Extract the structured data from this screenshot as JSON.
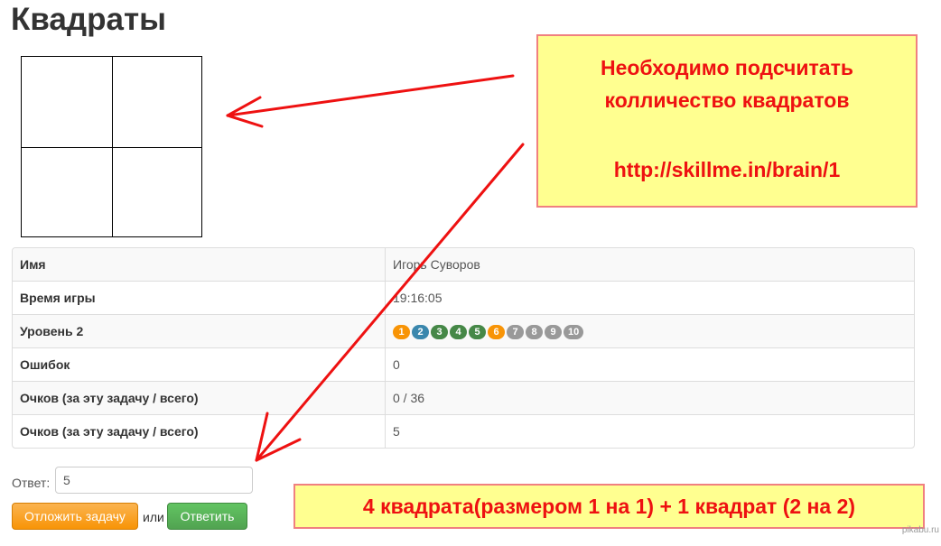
{
  "page": {
    "title": "Квадраты"
  },
  "table": {
    "rows": [
      {
        "label": "Имя",
        "value": "Игорь Суворов"
      },
      {
        "label": "Время игры",
        "value": "19:16:05"
      },
      {
        "label": "Уровень 2",
        "badges": [
          {
            "text": "1",
            "color": "#f89406"
          },
          {
            "text": "2",
            "color": "#3a87ad"
          },
          {
            "text": "3",
            "color": "#468847"
          },
          {
            "text": "4",
            "color": "#468847"
          },
          {
            "text": "5",
            "color": "#468847"
          },
          {
            "text": "6",
            "color": "#f89406"
          },
          {
            "text": "7",
            "color": "#999999"
          },
          {
            "text": "8",
            "color": "#999999"
          },
          {
            "text": "9",
            "color": "#999999"
          },
          {
            "text": "10",
            "color": "#999999"
          }
        ]
      },
      {
        "label": "Ошибок",
        "value": "0"
      },
      {
        "label": "Очков (за эту задачу / всего)",
        "value": "0 / 36"
      },
      {
        "label": "Очков (за эту задачу / всего)",
        "value": "5"
      }
    ]
  },
  "form": {
    "answer_label": "Ответ:",
    "answer_value": "5",
    "postpone_label": "Отложить задачу",
    "or_text": "или",
    "answer_button_label": "Ответить"
  },
  "annotations": {
    "note_line1": "Необходимо подсчитать",
    "note_line2": "колличество квадратов",
    "note_link": "http://skillme.in/brain/1",
    "solution": "4 квадрата(размером 1 на 1) + 1 квадрат (2 на 2)",
    "arrow_color": "#ee1111"
  },
  "watermark": "pikabu.ru"
}
